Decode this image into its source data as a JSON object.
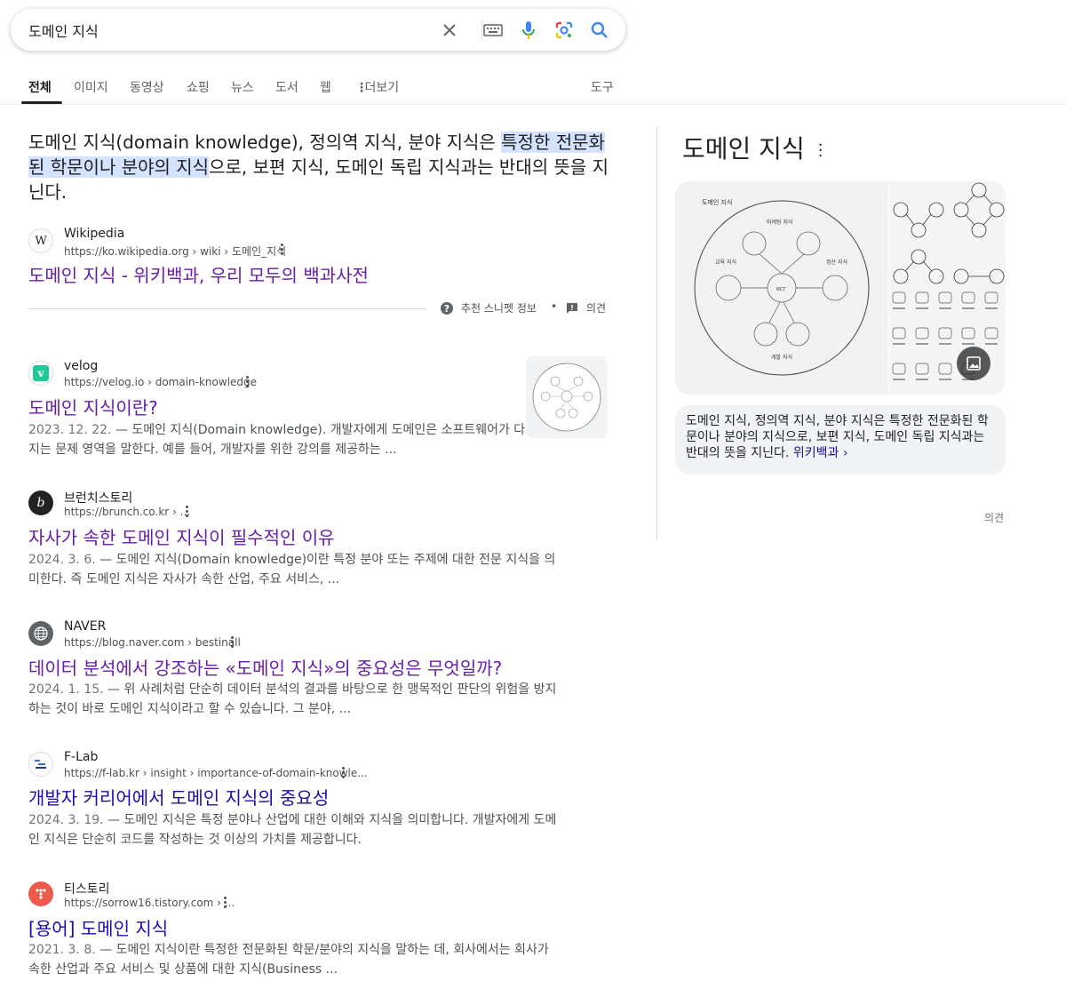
{
  "search": {
    "query": "도메인 지식"
  },
  "tabs": [
    {
      "label": "전체"
    },
    {
      "label": "이미지"
    },
    {
      "label": "동영상"
    },
    {
      "label": "쇼핑"
    },
    {
      "label": "뉴스"
    },
    {
      "label": "도서"
    },
    {
      "label": "웹"
    },
    {
      "label": "더보기"
    }
  ],
  "tools_label": "도구",
  "featured_snippet": {
    "text_before": "도메인 지식(domain knowledge), 정의역 지식, 분야 지식은 ",
    "highlight": "특정한 전문화된 학문이나 분야의 지식",
    "text_after": "으로, 보편 지식, 도메인 독립 지식과는 반대의 뜻을 지닌다.",
    "source": {
      "site_name": "Wikipedia",
      "url": "https://ko.wikipedia.org › wiki › 도메인_지식",
      "title": "도메인 지식 - 위키백과, 우리 모두의 백과사전"
    },
    "about_label": "추천 스니펫 정보",
    "feedback_label": "의견"
  },
  "results": [
    {
      "site_name": "velog",
      "url": "https://velog.io › domain-knowledge",
      "title": "도메인 지식이란?",
      "date": "2023. 12. 22.",
      "snippet": " — 도메인 지식(Domain knowledge). 개발자에게 도메인은 소프트웨어가 다루어지는 문제 영역을 말한다. 예를 들어, 개발자를 위한 강의를 제공하는 ..."
    },
    {
      "site_name": "브런치스토리",
      "url": "https://brunch.co.kr › ...",
      "title": "자사가 속한 도메인 지식이 필수적인 이유",
      "date": "2024. 3. 6.",
      "snippet": " — 도메인 지식(Domain knowledge)이란 특정 분야 또는 주제에 대한 전문 지식을 의미한다. 즉 도메인 지식은 자사가 속한 산업, 주요 서비스, ..."
    },
    {
      "site_name": "NAVER",
      "url": "https://blog.naver.com › bestinall",
      "title": "데이터 분석에서 강조하는 «도메인 지식»의 중요성은 무엇일까?",
      "date": "2024. 1. 15.",
      "snippet": " — 위 사례처럼 단순히 데이터 분석의 결과를 바탕으로 한 맹목적인 판단의 위험을 방지하는 것이 바로 도메인 지식이라고 할 수 있습니다. 그 분야, ..."
    },
    {
      "site_name": "F-Lab",
      "url": "https://f-lab.kr › insight › importance-of-domain-knowle...",
      "title": "개발자 커리어에서 도메인 지식의 중요성",
      "date": "2024. 3. 19.",
      "snippet": " — 도메인 지식은 특정 분야나 산업에 대한 이해와 지식을 의미합니다. 개발자에게 도메인 지식은 단순히 코드를 작성하는 것 이상의 가치를 제공합니다."
    },
    {
      "site_name": "티스토리",
      "url": "https://sorrow16.tistory.com › ...",
      "title": "[용어] 도메인 지식",
      "date": "2021. 3. 8.",
      "snippet": " — 도메인 지식이란 특정한 전문화된 학문/분야의 지식을 말하는 데, 회사에서는 회사가 속한 산업과 주요 서비스 및 상품에 대한 지식(Business ..."
    }
  ],
  "knowledge_panel": {
    "title": "도메인 지식",
    "description": "도메인 지식, 정의역 지식, 분야 지식은 특정한 전문화된 학문이나 분야의 지식으로, 보편 지식, 도메인 독립 지식과는 반대의 뜻을 지닌다.",
    "link_label": "위키백과 ›",
    "feedback_label": "의견",
    "diagram": {
      "outer_label": "도메인 지식",
      "sections": [
        "마케팅 지식",
        "교육 지식",
        "정산 지식",
        "개발 지식"
      ],
      "center": "NCT"
    }
  },
  "colors": {
    "visited_link": "#681da8",
    "link": "#1a0dab",
    "highlight": "#d3e3fd",
    "accent_blue": "#4285f4"
  }
}
